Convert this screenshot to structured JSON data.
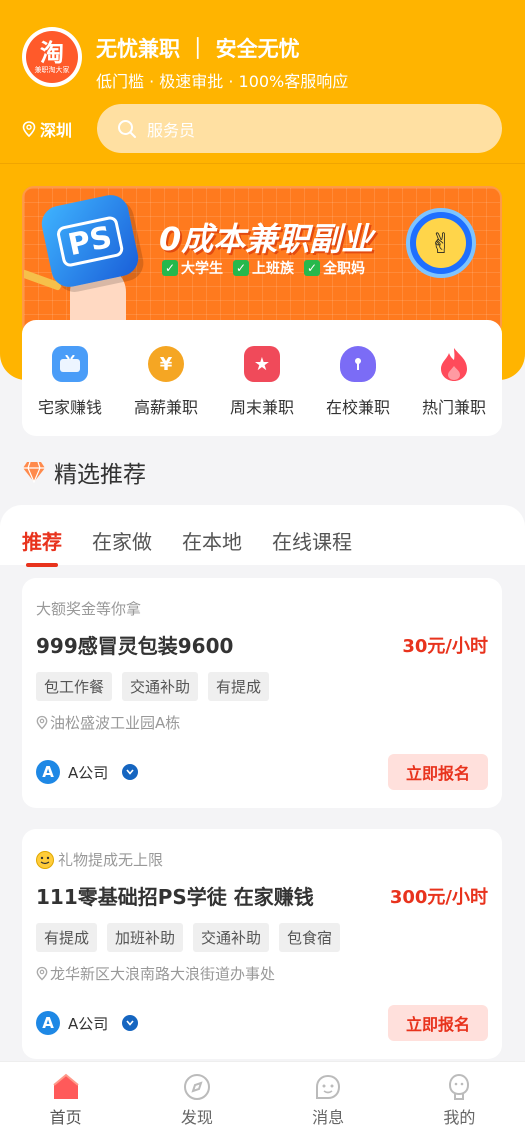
{
  "header": {
    "logo_big": "淘",
    "logo_small": "兼职淘大家",
    "slogan": "无忧兼职 ｜ 安全无忧",
    "subslogan": "低门槛 · 极速审批 · 100%客服响应",
    "city": "深圳",
    "search_placeholder": "服务员"
  },
  "banner": {
    "ps_label": "PS",
    "title": "0成本兼职副业",
    "tags": [
      "大学生",
      "上班族",
      "全职妈"
    ],
    "badge_icon": "✌"
  },
  "categories": [
    {
      "label": "宅家赚钱",
      "icon": "tv-icon",
      "color": "#4a9df8"
    },
    {
      "label": "高薪兼职",
      "icon": "yen-icon",
      "color": "#f5a623"
    },
    {
      "label": "周末兼职",
      "icon": "calendar-icon",
      "color": "#f04a5a"
    },
    {
      "label": "在校兼职",
      "icon": "shield-icon",
      "color": "#7b6cf6"
    },
    {
      "label": "热门兼职",
      "icon": "fire-icon",
      "color": "#ff4a5a"
    }
  ],
  "section": {
    "title": "精选推荐"
  },
  "tabs": [
    "推荐",
    "在家做",
    "在本地",
    "在线课程"
  ],
  "jobs": [
    {
      "hint": "大额奖金等你拿",
      "title": "999感冒灵包装9600",
      "salary": "30元/小时",
      "tags": [
        "包工作餐",
        "交通补助",
        "有提成"
      ],
      "address": "油松盛波工业园A栋",
      "company": "A公司",
      "apply": "立即报名"
    },
    {
      "hint": "礼物提成无上限",
      "title": "111零基础招PS学徒 在家赚钱",
      "salary": "300元/小时",
      "tags": [
        "有提成",
        "加班补助",
        "交通补助",
        "包食宿"
      ],
      "address": "龙华新区大浪南路大浪街道办事处",
      "company": "A公司",
      "apply": "立即报名"
    }
  ],
  "tabbar": [
    {
      "label": "首页",
      "icon": "home-icon"
    },
    {
      "label": "发现",
      "icon": "discover-icon"
    },
    {
      "label": "消息",
      "icon": "message-icon"
    },
    {
      "label": "我的",
      "icon": "profile-icon"
    }
  ],
  "colors": {
    "brand": "#ffb400",
    "accent": "#e8331d"
  }
}
